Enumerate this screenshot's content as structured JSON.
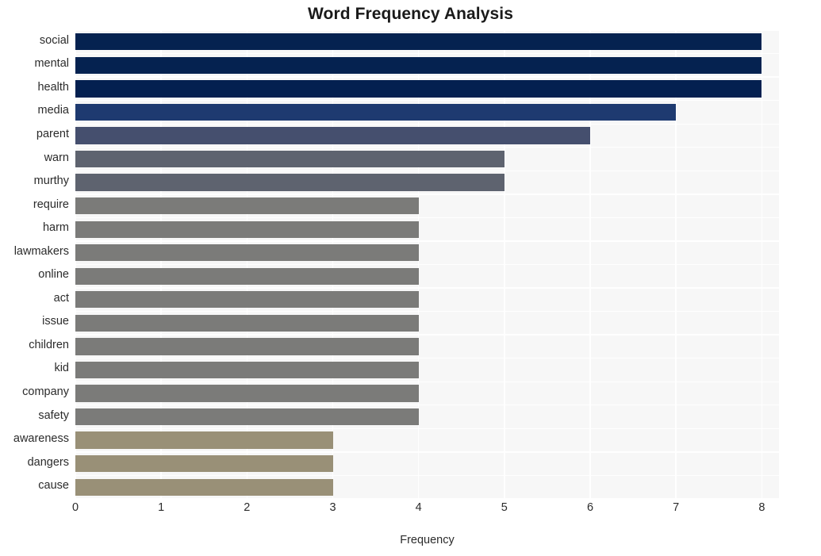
{
  "chart_data": {
    "type": "bar",
    "orientation": "horizontal",
    "title": "Word Frequency Analysis",
    "xlabel": "Frequency",
    "ylabel": "",
    "xlim": [
      0,
      8.2
    ],
    "xticks": [
      0,
      1,
      2,
      3,
      4,
      5,
      6,
      7,
      8
    ],
    "xtick_labels": [
      "0",
      "1",
      "2",
      "3",
      "4",
      "5",
      "6",
      "7",
      "8"
    ],
    "grid": true,
    "legend": null,
    "categories": [
      "social",
      "mental",
      "health",
      "media",
      "parent",
      "warn",
      "murthy",
      "require",
      "harm",
      "lawmakers",
      "online",
      "act",
      "issue",
      "children",
      "kid",
      "company",
      "safety",
      "awareness",
      "dangers",
      "cause"
    ],
    "values": [
      8,
      8,
      8,
      7,
      6,
      5,
      5,
      4,
      4,
      4,
      4,
      4,
      4,
      4,
      4,
      4,
      4,
      3,
      3,
      3
    ],
    "bar_colors": [
      "#052250",
      "#052250",
      "#042050",
      "#1e3a70",
      "#454f6e",
      "#5e636f",
      "#5e636f",
      "#7b7b79",
      "#7b7b79",
      "#7b7b79",
      "#7b7b79",
      "#7b7b79",
      "#7b7b79",
      "#7b7b79",
      "#7b7b79",
      "#7b7b79",
      "#7b7b79",
      "#999077",
      "#999077",
      "#999077"
    ]
  },
  "style": {
    "plot_background": "#f7f7f7",
    "figure_background": "#ffffff",
    "gridline_color": "#ffffff",
    "text_color": "#2b2b2b",
    "title_color": "#1a1a1a"
  }
}
